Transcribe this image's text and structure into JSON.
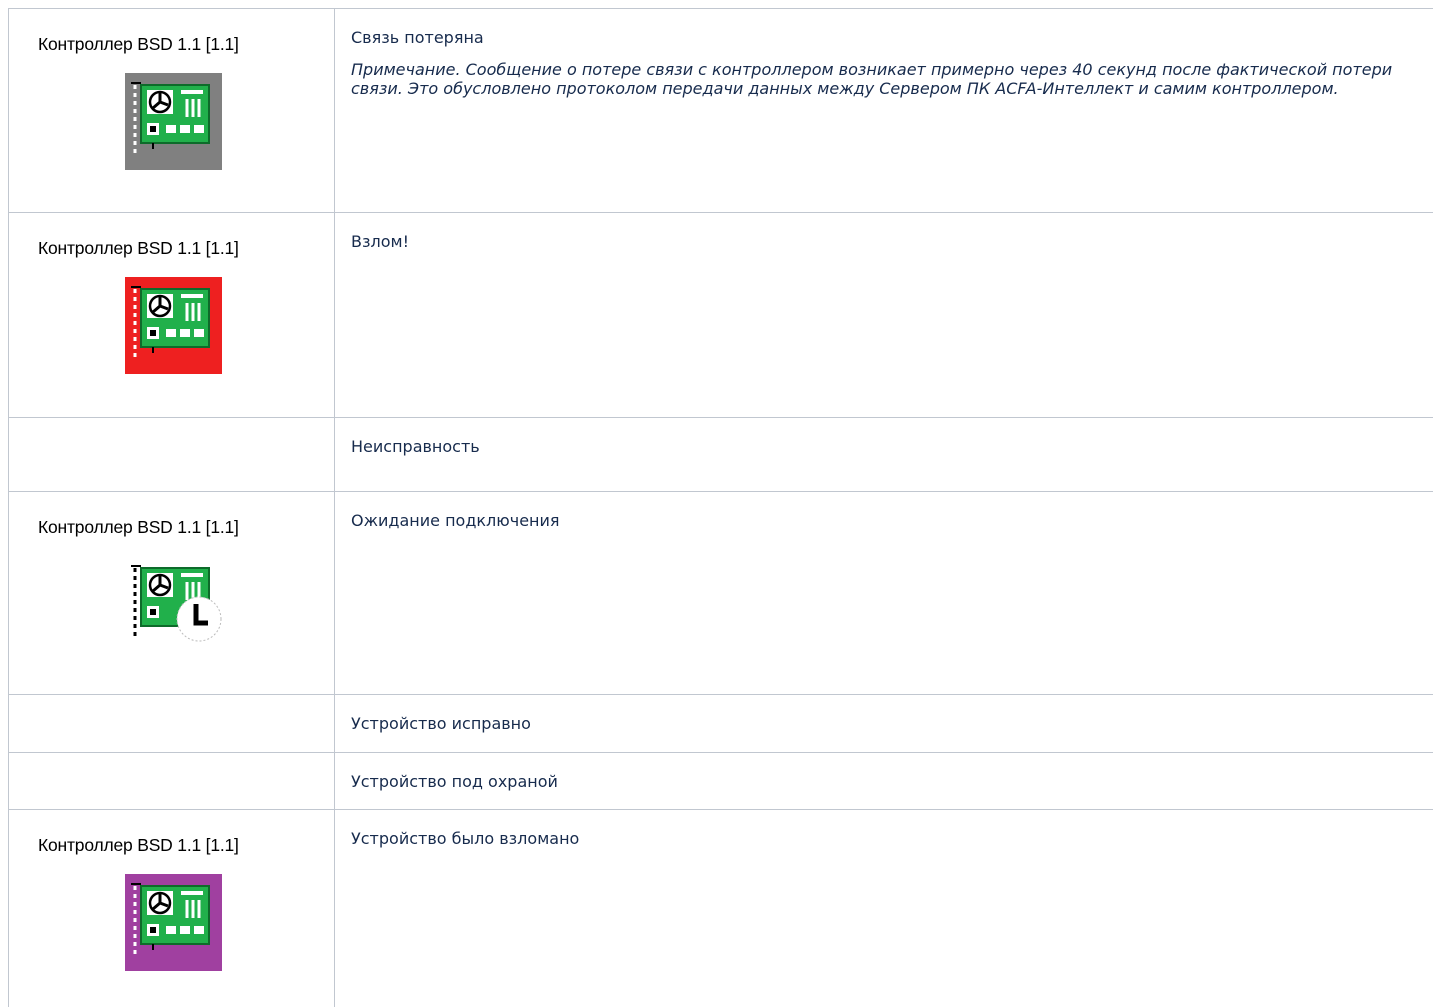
{
  "controller_label": "Контроллер BSD 1.1 [1.1]",
  "rows": [
    {
      "icon": "controller-board-icon",
      "icon_bg": "#808080",
      "title": "Связь потеряна",
      "note_head": "Примечание.",
      "note_body": " Сообщение о потере связи с контроллером возникает примерно через 40 секунд после фактической потери связи. Это обусловлено протоколом передачи данных между Сервером ПК ACFA-Интеллект и самим контроллером."
    },
    {
      "icon": "controller-board-icon",
      "icon_bg": "#ee2020",
      "title": "Взлом!"
    },
    {
      "title": "Неисправность"
    },
    {
      "icon": "controller-board-clock-icon",
      "icon_bg": "#ffffff",
      "title": "Ожидание подключения"
    },
    {
      "title": "Устройство исправно"
    },
    {
      "title": "Устройство под охраной"
    },
    {
      "icon": "controller-board-icon",
      "icon_bg": "#a040a0",
      "title": "Устройство было взломано"
    }
  ]
}
